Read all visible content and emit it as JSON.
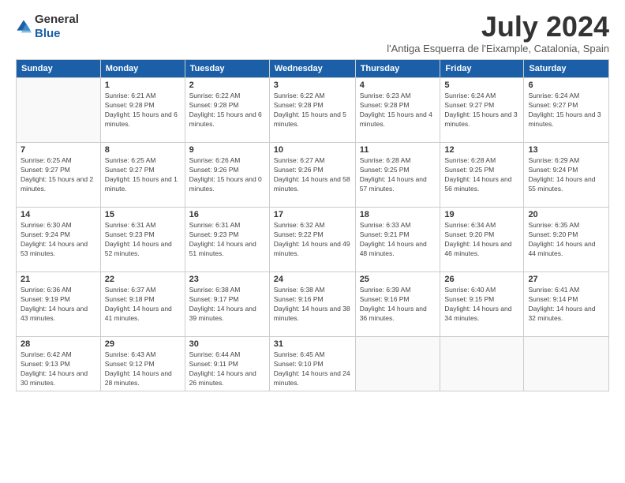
{
  "header": {
    "logo_general": "General",
    "logo_blue": "Blue",
    "month_title": "July 2024",
    "location": "l'Antiga Esquerra de l'Eixample, Catalonia, Spain"
  },
  "weekdays": [
    "Sunday",
    "Monday",
    "Tuesday",
    "Wednesday",
    "Thursday",
    "Friday",
    "Saturday"
  ],
  "weeks": [
    [
      {
        "day": "",
        "sunrise": "",
        "sunset": "",
        "daylight": ""
      },
      {
        "day": "1",
        "sunrise": "Sunrise: 6:21 AM",
        "sunset": "Sunset: 9:28 PM",
        "daylight": "Daylight: 15 hours and 6 minutes."
      },
      {
        "day": "2",
        "sunrise": "Sunrise: 6:22 AM",
        "sunset": "Sunset: 9:28 PM",
        "daylight": "Daylight: 15 hours and 6 minutes."
      },
      {
        "day": "3",
        "sunrise": "Sunrise: 6:22 AM",
        "sunset": "Sunset: 9:28 PM",
        "daylight": "Daylight: 15 hours and 5 minutes."
      },
      {
        "day": "4",
        "sunrise": "Sunrise: 6:23 AM",
        "sunset": "Sunset: 9:28 PM",
        "daylight": "Daylight: 15 hours and 4 minutes."
      },
      {
        "day": "5",
        "sunrise": "Sunrise: 6:24 AM",
        "sunset": "Sunset: 9:27 PM",
        "daylight": "Daylight: 15 hours and 3 minutes."
      },
      {
        "day": "6",
        "sunrise": "Sunrise: 6:24 AM",
        "sunset": "Sunset: 9:27 PM",
        "daylight": "Daylight: 15 hours and 3 minutes."
      }
    ],
    [
      {
        "day": "7",
        "sunrise": "Sunrise: 6:25 AM",
        "sunset": "Sunset: 9:27 PM",
        "daylight": "Daylight: 15 hours and 2 minutes."
      },
      {
        "day": "8",
        "sunrise": "Sunrise: 6:25 AM",
        "sunset": "Sunset: 9:27 PM",
        "daylight": "Daylight: 15 hours and 1 minute."
      },
      {
        "day": "9",
        "sunrise": "Sunrise: 6:26 AM",
        "sunset": "Sunset: 9:26 PM",
        "daylight": "Daylight: 15 hours and 0 minutes."
      },
      {
        "day": "10",
        "sunrise": "Sunrise: 6:27 AM",
        "sunset": "Sunset: 9:26 PM",
        "daylight": "Daylight: 14 hours and 58 minutes."
      },
      {
        "day": "11",
        "sunrise": "Sunrise: 6:28 AM",
        "sunset": "Sunset: 9:25 PM",
        "daylight": "Daylight: 14 hours and 57 minutes."
      },
      {
        "day": "12",
        "sunrise": "Sunrise: 6:28 AM",
        "sunset": "Sunset: 9:25 PM",
        "daylight": "Daylight: 14 hours and 56 minutes."
      },
      {
        "day": "13",
        "sunrise": "Sunrise: 6:29 AM",
        "sunset": "Sunset: 9:24 PM",
        "daylight": "Daylight: 14 hours and 55 minutes."
      }
    ],
    [
      {
        "day": "14",
        "sunrise": "Sunrise: 6:30 AM",
        "sunset": "Sunset: 9:24 PM",
        "daylight": "Daylight: 14 hours and 53 minutes."
      },
      {
        "day": "15",
        "sunrise": "Sunrise: 6:31 AM",
        "sunset": "Sunset: 9:23 PM",
        "daylight": "Daylight: 14 hours and 52 minutes."
      },
      {
        "day": "16",
        "sunrise": "Sunrise: 6:31 AM",
        "sunset": "Sunset: 9:23 PM",
        "daylight": "Daylight: 14 hours and 51 minutes."
      },
      {
        "day": "17",
        "sunrise": "Sunrise: 6:32 AM",
        "sunset": "Sunset: 9:22 PM",
        "daylight": "Daylight: 14 hours and 49 minutes."
      },
      {
        "day": "18",
        "sunrise": "Sunrise: 6:33 AM",
        "sunset": "Sunset: 9:21 PM",
        "daylight": "Daylight: 14 hours and 48 minutes."
      },
      {
        "day": "19",
        "sunrise": "Sunrise: 6:34 AM",
        "sunset": "Sunset: 9:20 PM",
        "daylight": "Daylight: 14 hours and 46 minutes."
      },
      {
        "day": "20",
        "sunrise": "Sunrise: 6:35 AM",
        "sunset": "Sunset: 9:20 PM",
        "daylight": "Daylight: 14 hours and 44 minutes."
      }
    ],
    [
      {
        "day": "21",
        "sunrise": "Sunrise: 6:36 AM",
        "sunset": "Sunset: 9:19 PM",
        "daylight": "Daylight: 14 hours and 43 minutes."
      },
      {
        "day": "22",
        "sunrise": "Sunrise: 6:37 AM",
        "sunset": "Sunset: 9:18 PM",
        "daylight": "Daylight: 14 hours and 41 minutes."
      },
      {
        "day": "23",
        "sunrise": "Sunrise: 6:38 AM",
        "sunset": "Sunset: 9:17 PM",
        "daylight": "Daylight: 14 hours and 39 minutes."
      },
      {
        "day": "24",
        "sunrise": "Sunrise: 6:38 AM",
        "sunset": "Sunset: 9:16 PM",
        "daylight": "Daylight: 14 hours and 38 minutes."
      },
      {
        "day": "25",
        "sunrise": "Sunrise: 6:39 AM",
        "sunset": "Sunset: 9:16 PM",
        "daylight": "Daylight: 14 hours and 36 minutes."
      },
      {
        "day": "26",
        "sunrise": "Sunrise: 6:40 AM",
        "sunset": "Sunset: 9:15 PM",
        "daylight": "Daylight: 14 hours and 34 minutes."
      },
      {
        "day": "27",
        "sunrise": "Sunrise: 6:41 AM",
        "sunset": "Sunset: 9:14 PM",
        "daylight": "Daylight: 14 hours and 32 minutes."
      }
    ],
    [
      {
        "day": "28",
        "sunrise": "Sunrise: 6:42 AM",
        "sunset": "Sunset: 9:13 PM",
        "daylight": "Daylight: 14 hours and 30 minutes."
      },
      {
        "day": "29",
        "sunrise": "Sunrise: 6:43 AM",
        "sunset": "Sunset: 9:12 PM",
        "daylight": "Daylight: 14 hours and 28 minutes."
      },
      {
        "day": "30",
        "sunrise": "Sunrise: 6:44 AM",
        "sunset": "Sunset: 9:11 PM",
        "daylight": "Daylight: 14 hours and 26 minutes."
      },
      {
        "day": "31",
        "sunrise": "Sunrise: 6:45 AM",
        "sunset": "Sunset: 9:10 PM",
        "daylight": "Daylight: 14 hours and 24 minutes."
      },
      {
        "day": "",
        "sunrise": "",
        "sunset": "",
        "daylight": ""
      },
      {
        "day": "",
        "sunrise": "",
        "sunset": "",
        "daylight": ""
      },
      {
        "day": "",
        "sunrise": "",
        "sunset": "",
        "daylight": ""
      }
    ]
  ]
}
